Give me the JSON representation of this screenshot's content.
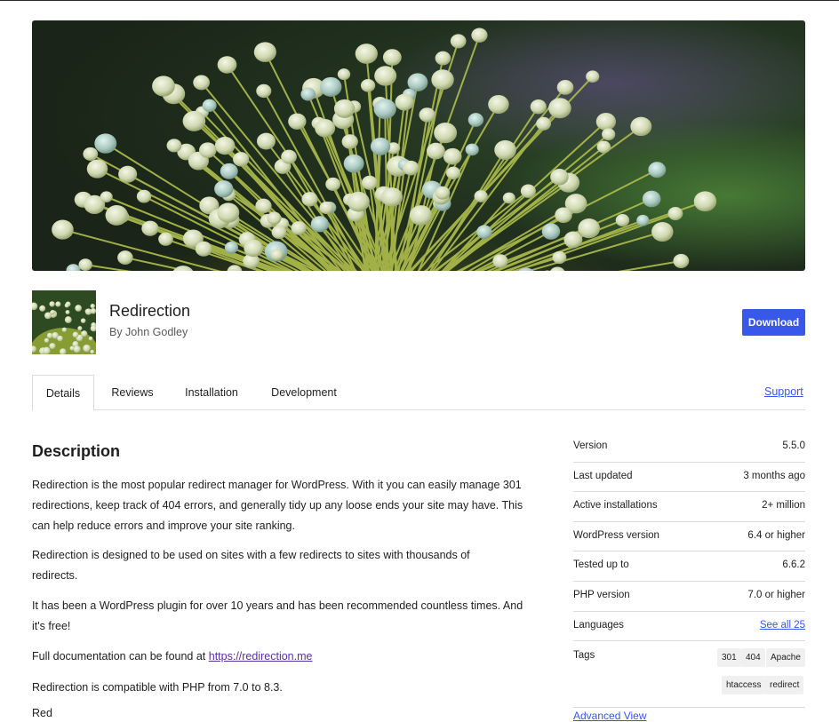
{
  "plugin": {
    "name": "Redirection",
    "author": "By John Godley",
    "download_label": "Download"
  },
  "tabs": [
    {
      "label": "Details",
      "active": true
    },
    {
      "label": "Reviews"
    },
    {
      "label": "Installation"
    },
    {
      "label": "Development"
    }
  ],
  "support_label": "Support",
  "description": {
    "title": "Description",
    "p1": "Redirection is the most popular redirect manager for WordPress. With it you can easily manage 301 redirections, keep track of 404 errors, and generally tidy up any loose ends your site may have. This can help reduce errors and improve your site ranking.",
    "p2": "Redirection is designed to be used on sites with a few redirects to sites with thousands of redirects.",
    "p3": "It has been a WordPress plugin for over 10 years and has been recommended countless times. And it's free!",
    "p4_prefix": "Full documentation can be found at ",
    "p4_link": "https://redirection.me",
    "p5": "Redirection is compatible with PHP from 7.0 to 8.3.",
    "next_heading_partial": "Red"
  },
  "meta": [
    {
      "key": "Version",
      "value": "5.5.0"
    },
    {
      "key": "Last updated",
      "value": "3 months ago"
    },
    {
      "key": "Active installations",
      "value": "2+ million"
    },
    {
      "key": "WordPress version",
      "value": "6.4 or higher"
    },
    {
      "key": "Tested up to",
      "value": "6.6.2"
    },
    {
      "key": "PHP version",
      "value": "7.0 or higher"
    },
    {
      "key": "Languages",
      "value": "See all 25"
    }
  ],
  "tags_label": "Tags",
  "tags": [
    "301",
    "404",
    "Apache",
    "htaccess",
    "redirect"
  ],
  "advanced_view_label": "Advanced View",
  "colors": {
    "accent": "#3858e9",
    "visited_link": "#5b2fa8",
    "border": "#dcdcde"
  }
}
